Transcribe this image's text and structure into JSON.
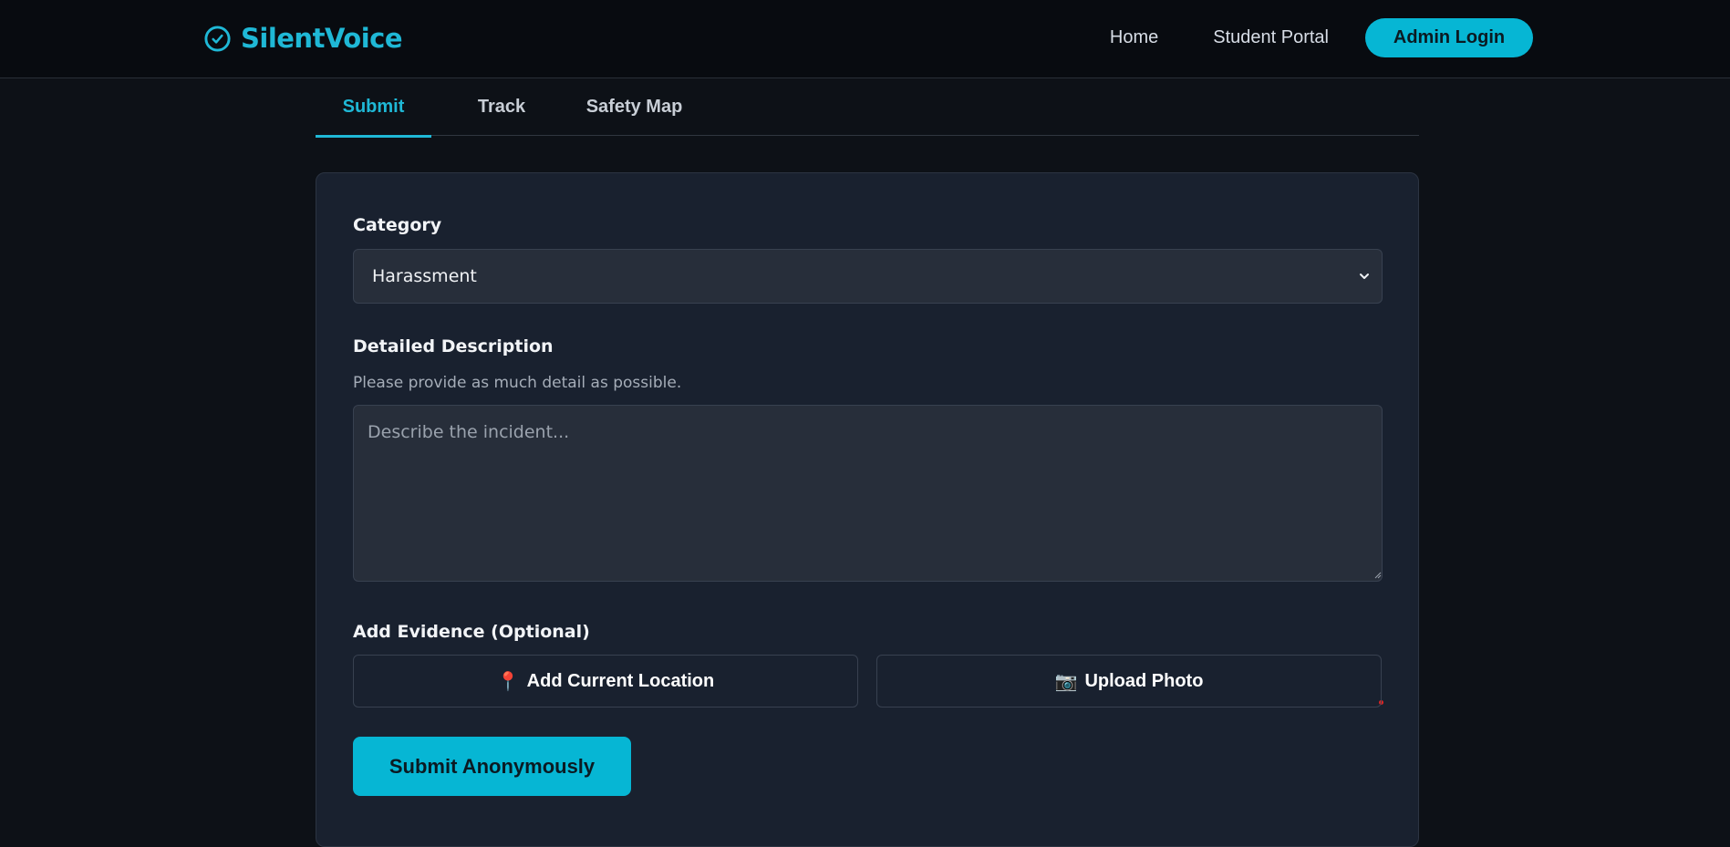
{
  "header": {
    "brand_name": "SilentVoice",
    "nav": {
      "home": "Home",
      "student_portal": "Student Portal",
      "admin_login": "Admin Login"
    }
  },
  "tabs": [
    {
      "label": "Submit",
      "active": true
    },
    {
      "label": "Track",
      "active": false
    },
    {
      "label": "Safety Map",
      "active": false
    }
  ],
  "form": {
    "category": {
      "label": "Category",
      "selected": "Harassment"
    },
    "description": {
      "label": "Detailed Description",
      "hint": "Please provide as much detail as possible.",
      "placeholder": "Describe the incident...",
      "value": ""
    },
    "evidence": {
      "label": "Add Evidence (Optional)",
      "location_button": "Add Current Location",
      "location_icon": "📍",
      "photo_button": "Upload Photo",
      "photo_icon": "📷"
    },
    "submit_label": "Submit Anonymously"
  },
  "colors": {
    "accent": "#06b6d4",
    "brand": "#1fb8d6",
    "background": "#0d1117",
    "card": "#19212f"
  },
  "icons": {
    "brand": "check-circle-icon",
    "select": "chevron-down-icon",
    "location": "pin-icon",
    "photo": "camera-icon"
  }
}
